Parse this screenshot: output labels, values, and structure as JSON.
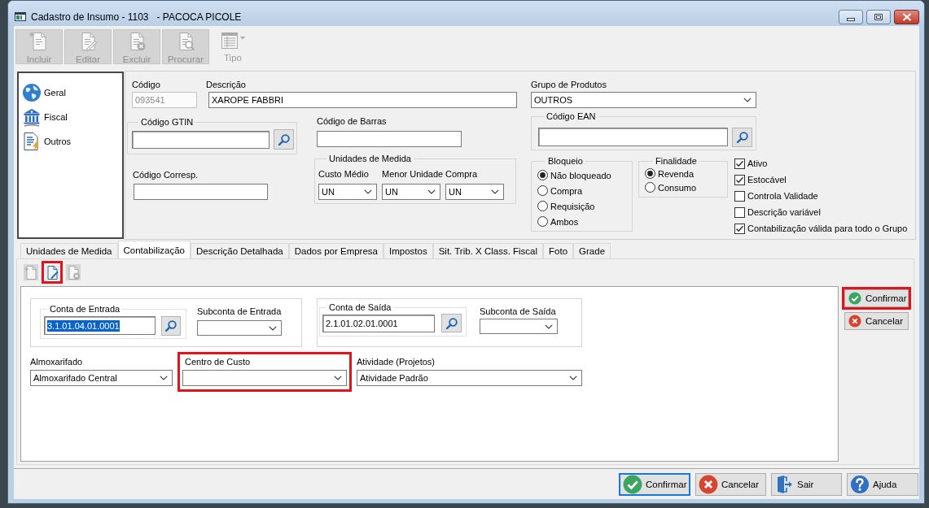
{
  "window": {
    "title": "Cadastro de Insumo - 1103   - PACOCA PICOLE"
  },
  "toolbar": [
    {
      "label": "Incluir",
      "kind": "new",
      "disabled": true
    },
    {
      "label": "Editar",
      "kind": "edit",
      "disabled": true
    },
    {
      "label": "Excluir",
      "kind": "delete",
      "disabled": true
    },
    {
      "label": "Procurar",
      "kind": "search",
      "disabled": true
    },
    {
      "label": "Tipo",
      "kind": "type",
      "disabled": true
    }
  ],
  "sidebar": {
    "items": [
      {
        "label": "Geral",
        "kind": "globe"
      },
      {
        "label": "Fiscal",
        "kind": "bank"
      },
      {
        "label": "Outros",
        "kind": "document"
      }
    ]
  },
  "product": {
    "code": {
      "label": "Código",
      "value": "093541",
      "disabled": true
    },
    "description": {
      "label": "Descrição",
      "value": "XAROPE FABBRI"
    },
    "product_group": {
      "label": "Grupo de Produtos",
      "value": "OUTROS"
    },
    "gtin_code": {
      "label": "Código GTIN"
    },
    "barcode": {
      "label": "Código de Barras"
    },
    "ean_code": {
      "label": "Código EAN"
    },
    "corresp_code": {
      "label": "Código Corresp."
    },
    "units": {
      "title": "Unidades de Medida",
      "fields": [
        {
          "label": "Custo Médio",
          "value": "UN"
        },
        {
          "label": "Menor Unidade",
          "value": "UN"
        },
        {
          "label": "Compra",
          "value": "UN"
        }
      ]
    },
    "blocking": {
      "title": "Bloqueio",
      "options": [
        {
          "label": "Não bloqueado",
          "selected": true
        },
        {
          "label": "Compra",
          "selected": false
        },
        {
          "label": "Requisição",
          "selected": false
        },
        {
          "label": "Ambos",
          "selected": false
        }
      ]
    },
    "purpose": {
      "title": "Finalidade",
      "options": [
        {
          "label": "Revenda",
          "selected": true
        },
        {
          "label": "Consumo",
          "selected": false
        }
      ]
    },
    "flags": [
      {
        "label": "Ativo",
        "checked": true
      },
      {
        "label": "Estocável",
        "checked": true
      },
      {
        "label": "Controla Validade",
        "checked": false
      },
      {
        "label": "Descrição variável",
        "checked": false
      },
      {
        "label": "Contabilização válida para todo o Grupo",
        "checked": true
      }
    ]
  },
  "tabs": [
    {
      "label": "Unidades de Medida",
      "selected": false
    },
    {
      "label": "Contabilização",
      "selected": true
    },
    {
      "label": "Descrição Detalhada",
      "selected": false
    },
    {
      "label": "Dados por Empresa",
      "selected": false
    },
    {
      "label": "Impostos",
      "selected": false
    },
    {
      "label": "Sit. Trib. X Class. Fiscal",
      "selected": false
    },
    {
      "label": "Foto",
      "selected": false
    },
    {
      "label": "Grade",
      "selected": false
    }
  ],
  "tab_toolbar": [
    {
      "kind": "new",
      "disabled": true,
      "highlighted": false
    },
    {
      "kind": "edit",
      "disabled": false,
      "highlighted": true
    },
    {
      "kind": "delete",
      "disabled": true,
      "highlighted": false
    }
  ],
  "accounting": {
    "entry_account": {
      "label": "Conta de Entrada",
      "value": "3.1.01.04.01.0001",
      "text_selected": true
    },
    "entry_subaccount": {
      "label": "Subconta de Entrada"
    },
    "exit_account": {
      "label": "Conta de Saída",
      "value": "2.1.01.02.01.0001",
      "text_selected": false
    },
    "exit_subaccount": {
      "label": "Subconta de Saída"
    },
    "bottom_fields": [
      {
        "label": "Almoxarifado",
        "value": "Almoxarifado Central",
        "highlighted": false
      },
      {
        "label": "Centro de Custo",
        "highlighted": true
      },
      {
        "label": "Atividade (Projetos)",
        "value": "Atividade Padrão",
        "highlighted": false
      }
    ]
  },
  "side_buttons": [
    {
      "label": "Confirmar",
      "kind": "confirm",
      "highlighted": true
    },
    {
      "label": "Cancelar",
      "kind": "cancel",
      "highlighted": false
    }
  ],
  "footer_buttons": [
    {
      "label": "Confirmar",
      "kind": "confirm",
      "focused": true
    },
    {
      "label": "Cancelar",
      "kind": "cancel",
      "focused": false
    },
    {
      "label": "Sair",
      "kind": "exit",
      "focused": false
    },
    {
      "label": "Ajuda",
      "kind": "help",
      "focused": false
    }
  ]
}
